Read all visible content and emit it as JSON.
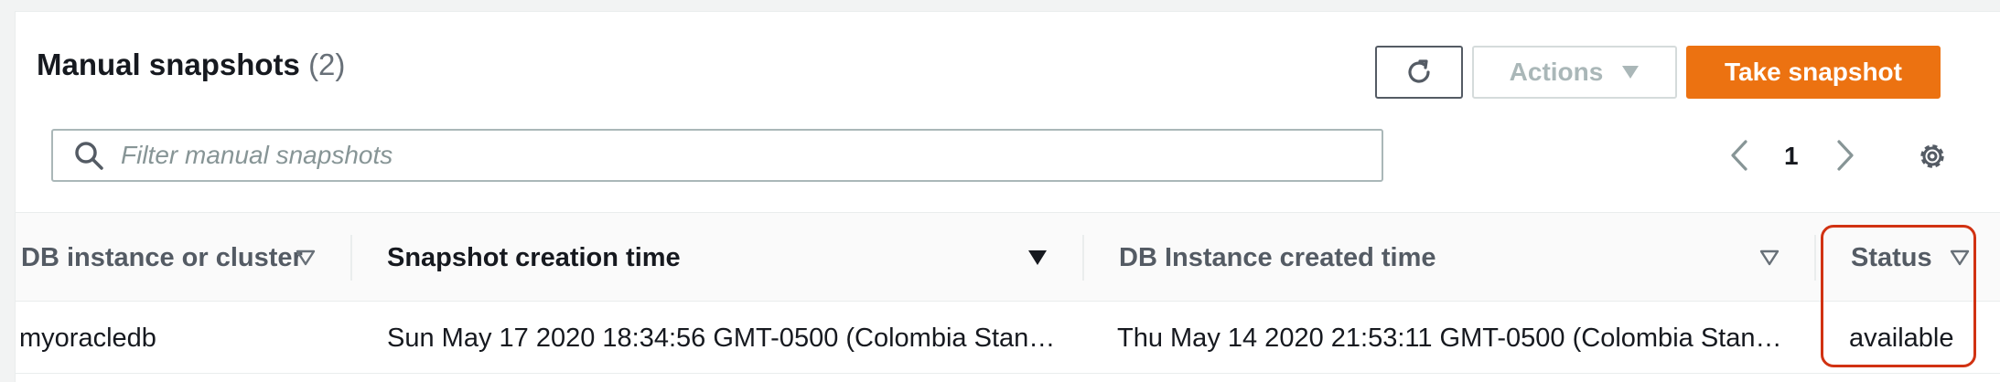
{
  "header": {
    "title": "Manual snapshots",
    "count": "(2)"
  },
  "toolbar": {
    "refresh_icon": "refresh-icon",
    "actions_label": "Actions",
    "take_snapshot_label": "Take snapshot"
  },
  "search": {
    "placeholder": "Filter manual snapshots",
    "value": ""
  },
  "pagination": {
    "current_page": "1"
  },
  "table": {
    "columns": [
      {
        "label": "DB instance or cluster",
        "sort": "unsorted"
      },
      {
        "label": "Snapshot creation time",
        "sort": "descending"
      },
      {
        "label": "DB Instance created time",
        "sort": "unsorted"
      },
      {
        "label": "Status",
        "sort": "unsorted"
      }
    ],
    "rows": [
      {
        "db_instance": "myoracledb",
        "snapshot_time": "Sun May 17 2020 18:34:56 GMT-0500 (Colombia Stan…",
        "instance_created": "Thu May 14 2020 21:53:11 GMT-0500 (Colombia Stan…",
        "status": "available"
      }
    ]
  },
  "colors": {
    "accent": "#ec7211",
    "highlight": "#d13212",
    "text": "#16191f",
    "muted": "#687078"
  }
}
